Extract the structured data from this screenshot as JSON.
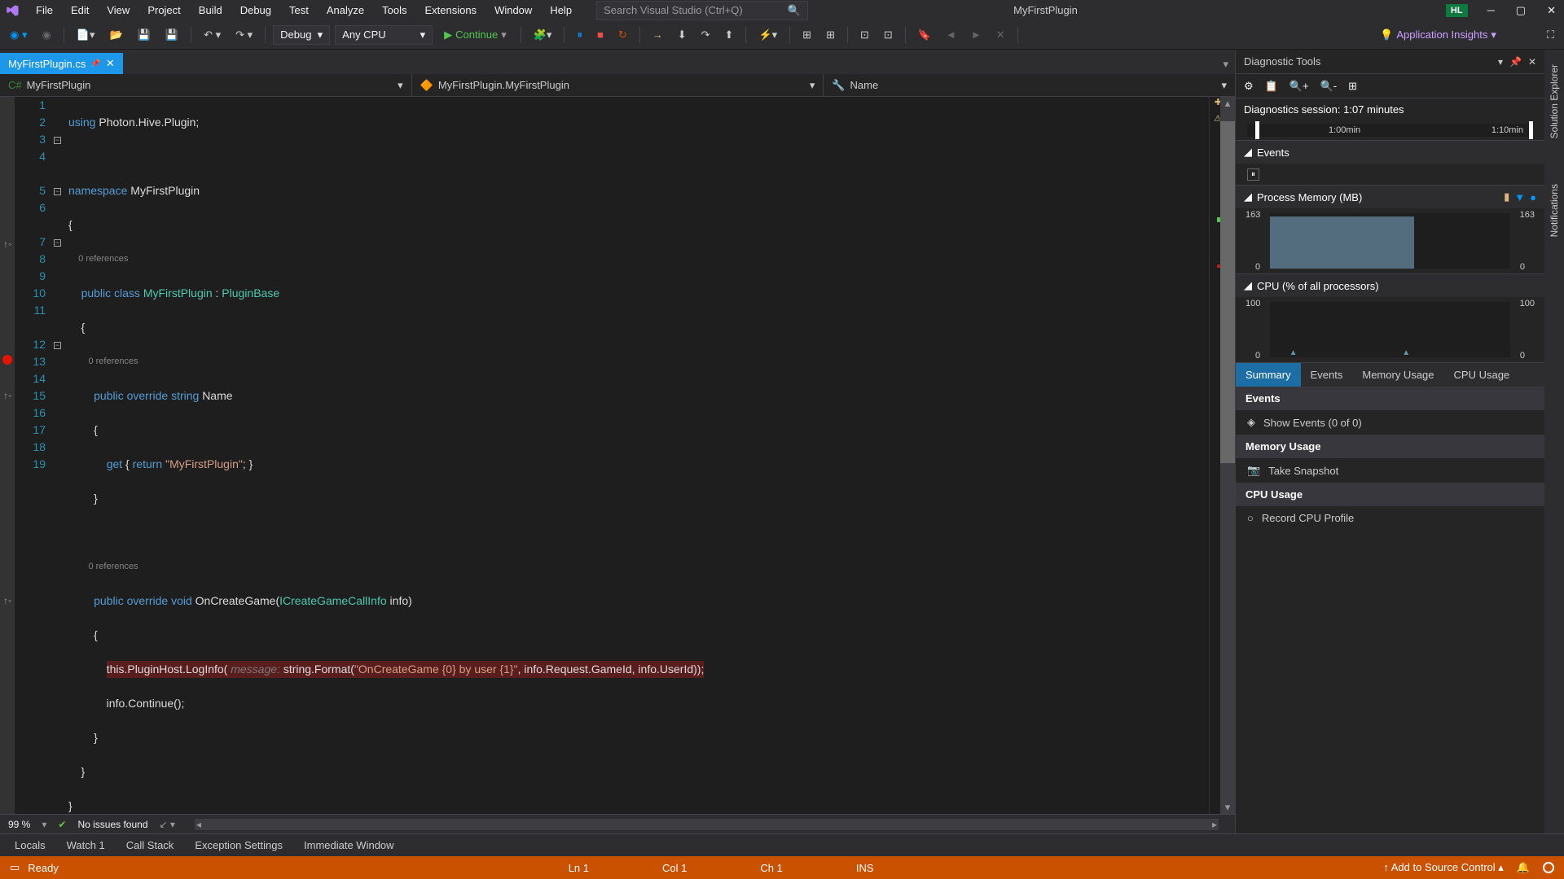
{
  "menu": [
    "File",
    "Edit",
    "View",
    "Project",
    "Build",
    "Debug",
    "Test",
    "Analyze",
    "Tools",
    "Extensions",
    "Window",
    "Help"
  ],
  "search_placeholder": "Search Visual Studio (Ctrl+Q)",
  "solution_name": "MyFirstPlugin",
  "user_initials": "HL",
  "toolbar": {
    "config": "Debug",
    "platform": "Any CPU",
    "continue": "Continue",
    "app_insights": "Application Insights"
  },
  "tab": {
    "name": "MyFirstPlugin.cs"
  },
  "nav": {
    "scope": "MyFirstPlugin",
    "class": "MyFirstPlugin.MyFirstPlugin",
    "member": "Name"
  },
  "code": {
    "codelens": "0 references",
    "l1": {
      "kw": "using",
      "rest": " Photon.Hive.Plugin;"
    },
    "l3": {
      "kw": "namespace",
      "name": " MyFirstPlugin"
    },
    "l4": "{",
    "l5": {
      "mods": "public class ",
      "name": "MyFirstPlugin",
      "rest": " : ",
      "base": "PluginBase"
    },
    "l6": "    {",
    "l8": {
      "mods": "public override string ",
      "name": "Name"
    },
    "l9": "        {",
    "l10": {
      "get": "get",
      "ret": "return",
      "str": "\"MyFirstPlugin\"",
      "rest": "; }"
    },
    "l11": "        }",
    "l13": {
      "mods": "public override void ",
      "name": "OnCreateGame",
      "sig1": "(",
      "ptype": "ICreateGameCallInfo",
      "sig2": " info)"
    },
    "l14": "        {",
    "l15": {
      "pre": "this.PluginHost.LogInfo(",
      "hint": " message: ",
      "mid": "string.Format(",
      "str": "\"OnCreateGame {0} by user {1}\"",
      "post": ", info.Request.GameId, info.UserId));"
    },
    "l16": "            info.Continue();",
    "l17": "        }",
    "l18": "    }",
    "l19": "}"
  },
  "editor_status": {
    "zoom": "99 %",
    "issues": "No issues found"
  },
  "diag": {
    "title": "Diagnostic Tools",
    "session": "Diagnostics session: 1:07 minutes",
    "time1": "1:00min",
    "time2": "1:10min",
    "events_hdr": "Events",
    "mem_hdr": "Process Memory (MB)",
    "mem_max": "163",
    "mem_min": "0",
    "cpu_hdr": "CPU (% of all processors)",
    "cpu_max": "100",
    "cpu_min": "0",
    "tabs": [
      "Summary",
      "Events",
      "Memory Usage",
      "CPU Usage"
    ],
    "groups": {
      "events": "Events",
      "events_action": "Show Events (0 of 0)",
      "mem": "Memory Usage",
      "mem_action": "Take Snapshot",
      "cpu": "CPU Usage",
      "cpu_action": "Record CPU Profile"
    }
  },
  "side_tabs": [
    "Solution Explorer",
    "Notifications"
  ],
  "bottom_tabs": [
    "Locals",
    "Watch 1",
    "Call Stack",
    "Exception Settings",
    "Immediate Window"
  ],
  "status": {
    "ready": "Ready",
    "ln": "Ln 1",
    "col": "Col 1",
    "ch": "Ch 1",
    "ins": "INS",
    "source_control": "Add to Source Control"
  }
}
